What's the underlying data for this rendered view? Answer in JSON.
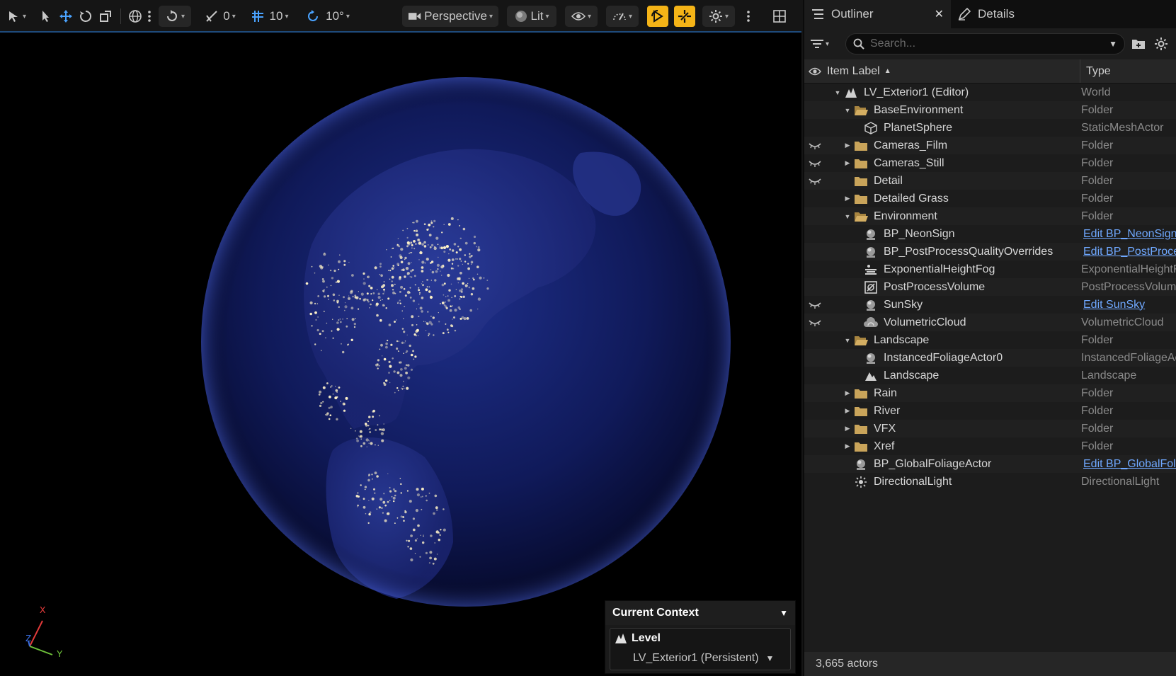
{
  "toolbar": {
    "snap_angle_value": "0",
    "grid_value": "10",
    "rotate_snap_value": "10°",
    "view_mode": "Perspective",
    "lit_mode": "Lit"
  },
  "context": {
    "title": "Current Context",
    "level_label": "Level",
    "level_value": "LV_Exterior1 (Persistent)"
  },
  "axis": {
    "x": "X",
    "y": "Y",
    "z": "Z"
  },
  "tabs": {
    "outliner": "Outliner",
    "details": "Details"
  },
  "search": {
    "placeholder": "Search..."
  },
  "columns": {
    "label": "Item Label",
    "type": "Type"
  },
  "status": {
    "actors": "3,665 actors"
  },
  "colors": {
    "accent": "#f5b417",
    "link": "#6fa8ff",
    "folder": "#c9a45a"
  },
  "rows": [
    {
      "label": "LV_Exterior1 (Editor)",
      "type": "World",
      "depth": 0,
      "expand": "open",
      "icon": "world-icon",
      "hidden": false,
      "link": false
    },
    {
      "label": "BaseEnvironment",
      "type": "Folder",
      "depth": 1,
      "expand": "open",
      "icon": "folder-open-icon",
      "hidden": false,
      "link": false
    },
    {
      "label": "PlanetSphere",
      "type": "StaticMeshActor",
      "depth": 2,
      "expand": "none",
      "icon": "static-mesh-icon",
      "hidden": false,
      "link": false
    },
    {
      "label": "Cameras_Film",
      "type": "Folder",
      "depth": 1,
      "expand": "closed",
      "icon": "folder-icon",
      "hidden": true,
      "link": false
    },
    {
      "label": "Cameras_Still",
      "type": "Folder",
      "depth": 1,
      "expand": "closed",
      "icon": "folder-icon",
      "hidden": true,
      "link": false
    },
    {
      "label": "Detail",
      "type": "Folder",
      "depth": 1,
      "expand": "none",
      "icon": "folder-icon",
      "hidden": true,
      "link": false
    },
    {
      "label": "Detailed Grass",
      "type": "Folder",
      "depth": 1,
      "expand": "closed",
      "icon": "folder-icon",
      "hidden": false,
      "link": false
    },
    {
      "label": "Environment",
      "type": "Folder",
      "depth": 1,
      "expand": "open",
      "icon": "folder-open-icon",
      "hidden": false,
      "link": false
    },
    {
      "label": "BP_NeonSign",
      "type": "Edit BP_NeonSign",
      "depth": 2,
      "expand": "none",
      "icon": "actor-icon",
      "hidden": false,
      "link": true
    },
    {
      "label": "BP_PostProcessQualityOverrides",
      "type": "Edit BP_PostProcessQualityOverrides",
      "depth": 2,
      "expand": "none",
      "icon": "actor-icon",
      "hidden": false,
      "link": true
    },
    {
      "label": "ExponentialHeightFog",
      "type": "ExponentialHeightFog",
      "depth": 2,
      "expand": "none",
      "icon": "fog-icon",
      "hidden": false,
      "link": false
    },
    {
      "label": "PostProcessVolume",
      "type": "PostProcessVolume",
      "depth": 2,
      "expand": "none",
      "icon": "volume-icon",
      "hidden": false,
      "link": false
    },
    {
      "label": "SunSky",
      "type": "Edit SunSky",
      "depth": 2,
      "expand": "none",
      "icon": "actor-icon",
      "hidden": true,
      "link": true
    },
    {
      "label": "VolumetricCloud",
      "type": "VolumetricCloud",
      "depth": 2,
      "expand": "none",
      "icon": "cloud-icon",
      "hidden": true,
      "link": false
    },
    {
      "label": "Landscape",
      "type": "Folder",
      "depth": 1,
      "expand": "open",
      "icon": "folder-open-icon",
      "hidden": false,
      "link": false
    },
    {
      "label": "InstancedFoliageActor0",
      "type": "InstancedFoliageActor",
      "depth": 2,
      "expand": "none",
      "icon": "actor-icon",
      "hidden": false,
      "link": false
    },
    {
      "label": "Landscape",
      "type": "Landscape",
      "depth": 2,
      "expand": "none",
      "icon": "landscape-icon",
      "hidden": false,
      "link": false
    },
    {
      "label": "Rain",
      "type": "Folder",
      "depth": 1,
      "expand": "closed",
      "icon": "folder-icon",
      "hidden": false,
      "link": false
    },
    {
      "label": "River",
      "type": "Folder",
      "depth": 1,
      "expand": "closed",
      "icon": "folder-icon",
      "hidden": false,
      "link": false
    },
    {
      "label": "VFX",
      "type": "Folder",
      "depth": 1,
      "expand": "closed",
      "icon": "folder-icon",
      "hidden": false,
      "link": false
    },
    {
      "label": "Xref",
      "type": "Folder",
      "depth": 1,
      "expand": "closed",
      "icon": "folder-icon",
      "hidden": false,
      "link": false
    },
    {
      "label": "BP_GlobalFoliageActor",
      "type": "Edit BP_GlobalFoliageActor",
      "depth": 1,
      "expand": "none",
      "icon": "actor-icon",
      "hidden": false,
      "link": true
    },
    {
      "label": "DirectionalLight",
      "type": "DirectionalLight",
      "depth": 1,
      "expand": "none",
      "icon": "light-icon",
      "hidden": false,
      "link": false
    }
  ]
}
